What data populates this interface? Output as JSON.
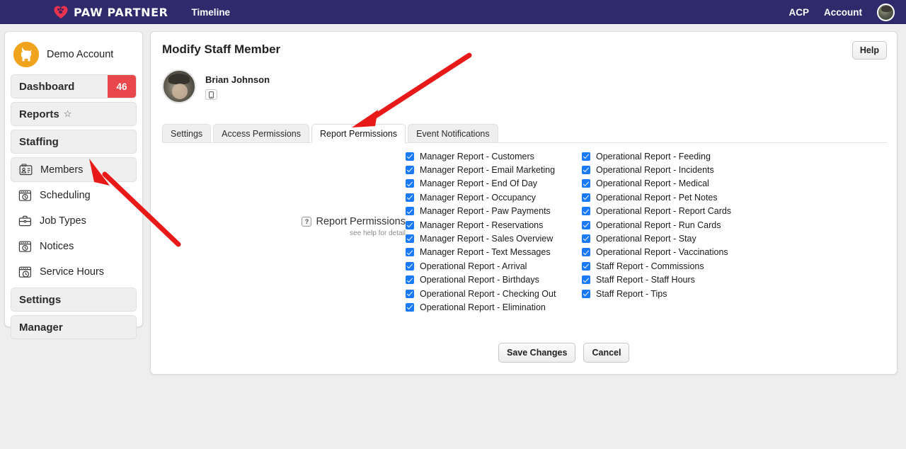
{
  "navbar": {
    "brand": "Paw Partner",
    "brand_icon": "heart-paw-icon",
    "timeline_label": "Timeline",
    "acp_label": "ACP",
    "account_label": "Account",
    "avatar_icon": "user-avatar",
    "background_color": "#2e2a6b"
  },
  "sidebar": {
    "account_name": "Demo Account",
    "account_icon": "dog-avatar-icon",
    "items": [
      {
        "label": "Dashboard",
        "badge": "46",
        "type": "box",
        "icon": null
      },
      {
        "label": "Reports",
        "badge": null,
        "type": "box",
        "icon": "star-icon",
        "star": "☆"
      },
      {
        "label": "Staffing",
        "badge": null,
        "type": "box",
        "icon": null
      },
      {
        "label": "Members",
        "badge": null,
        "type": "sub",
        "icon": "id-card-icon",
        "active": true
      },
      {
        "label": "Scheduling",
        "badge": null,
        "type": "sub",
        "icon": "calendar-clock-icon"
      },
      {
        "label": "Job Types",
        "badge": null,
        "type": "sub",
        "icon": "briefcase-icon"
      },
      {
        "label": "Notices",
        "badge": null,
        "type": "sub",
        "icon": "calendar-clock-icon"
      },
      {
        "label": "Service Hours",
        "badge": null,
        "type": "sub",
        "icon": "calendar-clock-icon"
      },
      {
        "label": "Settings",
        "badge": null,
        "type": "box",
        "icon": null
      },
      {
        "label": "Manager",
        "badge": null,
        "type": "box",
        "icon": null
      }
    ],
    "badge_color": "#e8484c"
  },
  "main": {
    "page_title": "Modify Staff Member",
    "help_button": "Help",
    "member": {
      "name": "Brian Johnson",
      "avatar_icon": "member-avatar",
      "phone_icon": "mobile-phone-icon"
    },
    "tabs": [
      {
        "label": "Settings",
        "active": false
      },
      {
        "label": "Access Permissions",
        "active": false
      },
      {
        "label": "Report Permissions",
        "active": true
      },
      {
        "label": "Event Notifications",
        "active": false
      }
    ],
    "field": {
      "help_icon": "?",
      "label": "Report Permissions",
      "sublabel": "see help for detail"
    },
    "checkbox_columns": [
      {
        "name": "left-column",
        "items": [
          {
            "label": "Manager Report - Customers",
            "checked": true
          },
          {
            "label": "Manager Report - Email Marketing",
            "checked": true
          },
          {
            "label": "Manager Report - End Of Day",
            "checked": true
          },
          {
            "label": "Manager Report - Occupancy",
            "checked": true
          },
          {
            "label": "Manager Report - Paw Payments",
            "checked": true
          },
          {
            "label": "Manager Report - Reservations",
            "checked": true
          },
          {
            "label": "Manager Report - Sales Overview",
            "checked": true
          },
          {
            "label": "Manager Report - Text Messages",
            "checked": true
          },
          {
            "label": "Operational Report - Arrival",
            "checked": true
          },
          {
            "label": "Operational Report - Birthdays",
            "checked": true
          },
          {
            "label": "Operational Report - Checking Out",
            "checked": true
          },
          {
            "label": "Operational Report - Elimination",
            "checked": true
          }
        ]
      },
      {
        "name": "right-column",
        "items": [
          {
            "label": "Operational Report - Feeding",
            "checked": true
          },
          {
            "label": "Operational Report - Incidents",
            "checked": true
          },
          {
            "label": "Operational Report - Medical",
            "checked": true
          },
          {
            "label": "Operational Report - Pet Notes",
            "checked": true
          },
          {
            "label": "Operational Report - Report Cards",
            "checked": true
          },
          {
            "label": "Operational Report - Run Cards",
            "checked": true
          },
          {
            "label": "Operational Report - Stay",
            "checked": true
          },
          {
            "label": "Operational Report - Vaccinations",
            "checked": true
          },
          {
            "label": "Staff Report - Commissions",
            "checked": true
          },
          {
            "label": "Staff Report - Staff Hours",
            "checked": true
          },
          {
            "label": "Staff Report - Tips",
            "checked": true
          }
        ]
      }
    ],
    "save_button": "Save Changes",
    "cancel_button": "Cancel"
  },
  "annotations": {
    "arrow_color": "#e81919",
    "arrows": [
      {
        "name": "arrow-to-report-permissions-tab",
        "points": "663 80 505 178"
      },
      {
        "name": "arrow-to-members-sidebar-item",
        "points": "252 345 128 228"
      }
    ]
  }
}
